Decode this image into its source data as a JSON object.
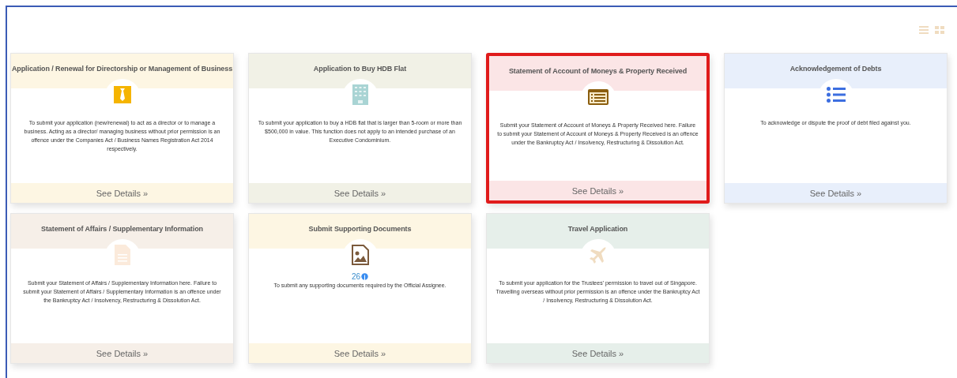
{
  "cards": [
    {
      "title": "Application / Renewal for Directorship or Management of Business",
      "kind": "tie",
      "color": "#fdf6e3",
      "description": "To submit your application (new/renewal) to act as a director or to manage a business. Acting as a director/ managing business without prior permission is an offence under the Companies Act / Business Names Registration Act 2014 respectively.",
      "link": "See Details »",
      "selected": false
    },
    {
      "title": "Application to Buy HDB Flat",
      "kind": "building",
      "color": "#f1f1e6",
      "description": "To submit your application to buy a HDB flat that is larger than 5-room or more than $500,000 in value. This function does not apply to an intended purchase of an Executive Condominium.",
      "link": "See Details »",
      "selected": false
    },
    {
      "title": "Statement of Account of Moneys & Property Received",
      "kind": "statement",
      "color": "#fbe5e6",
      "description": "Submit your Statement of Account of Moneys & Property Received here. Failure to submit your Statement of Account of Moneys & Property Received is an offence under the Bankruptcy Act / Insolvency, Restructuring & Dissolution Act.",
      "link": "See Details »",
      "selected": true
    },
    {
      "title": "Acknowledgement of Debts",
      "kind": "numbered",
      "color": "#e8effb",
      "description": "To acknowledge or dispute the proof of debt filed against you.",
      "link": "See Details »",
      "selected": false
    },
    {
      "title": "Statement of Affairs / Supplementary Information",
      "kind": "document",
      "color": "#f6efe8",
      "description": "Submit your Statement of Affairs / Supplementary Information here. Failure to submit your Statement of Affairs / Supplementary Information is an offence under the Bankruptcy Act / Insolvency, Restructuring & Dissolution Act.",
      "link": "See Details »",
      "selected": false
    },
    {
      "title": "Submit Supporting Documents",
      "kind": "image",
      "color": "#fdf6e3",
      "count": "26",
      "description": "To submit any supporting documents required by the Official Assignee.",
      "link": "See Details »",
      "selected": false
    },
    {
      "title": "Travel Application",
      "kind": "plane",
      "color": "#e6efea",
      "description": "To submit your application for the Trustees' permission to travel out of Singapore. Travelling overseas without prior permission is an offence under the Bankruptcy Act / Insolvency, Restructuring & Dissolution Act.",
      "link": "See Details »",
      "selected": false
    }
  ]
}
